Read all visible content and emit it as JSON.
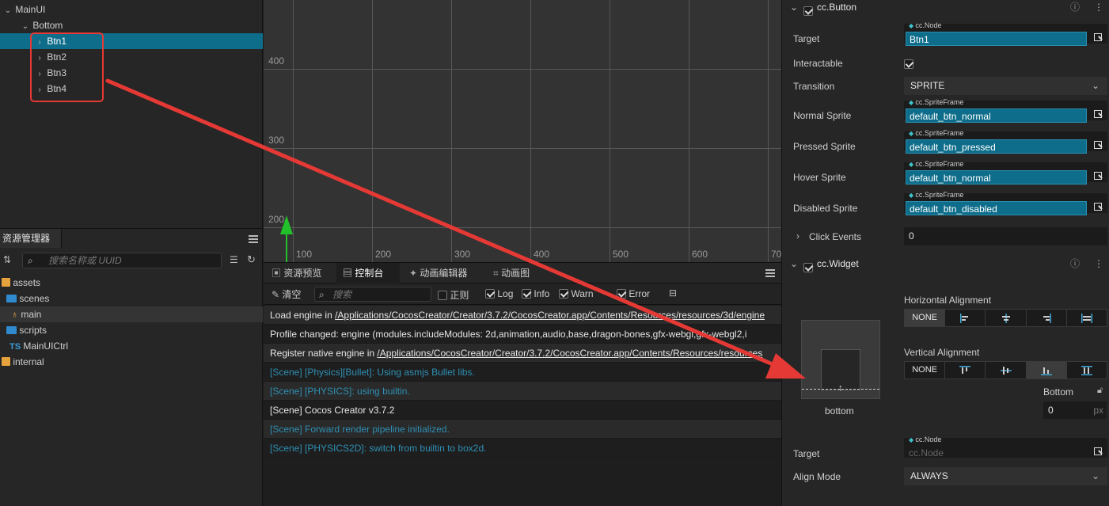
{
  "hierarchy": {
    "rows": [
      {
        "label": "MainUI"
      },
      {
        "label": "Bottom"
      },
      {
        "label": "Btn1"
      },
      {
        "label": "Btn2"
      },
      {
        "label": "Btn3"
      },
      {
        "label": "Btn4"
      }
    ]
  },
  "assets_panel": {
    "title": "资源管理器",
    "search_placeholder": "搜索名称或 UUID",
    "items": [
      {
        "label": "assets"
      },
      {
        "label": "scenes"
      },
      {
        "label": "main"
      },
      {
        "label": "scripts"
      },
      {
        "label": "MainUICtrl",
        "badge": "TS"
      },
      {
        "label": "internal"
      }
    ]
  },
  "scene": {
    "y_ticks": [
      "400",
      "300",
      "200"
    ],
    "x_ticks": [
      "100",
      "200",
      "300",
      "400",
      "500",
      "600",
      "70"
    ]
  },
  "console": {
    "tabs": [
      {
        "label": "资源预览"
      },
      {
        "label": "控制台"
      },
      {
        "label": "动画编辑器"
      },
      {
        "label": "动画图"
      }
    ],
    "clear_label": "清空",
    "search_placeholder": "搜索",
    "filters": [
      {
        "label": "正则",
        "checked": false
      },
      {
        "label": "Log",
        "checked": true
      },
      {
        "label": "Info",
        "checked": true
      },
      {
        "label": "Warn",
        "checked": true
      },
      {
        "label": "Error",
        "checked": true
      }
    ],
    "logs": [
      {
        "prefix": "Load engine in ",
        "link": "/Applications/CocosCreator/Creator/3.7.2/CocosCreator.app/Contents/Resources/resources/3d/engine"
      },
      {
        "prefix": "Profile changed: engine (modules.includeModules: 2d,animation,audio,base,dragon-bones,gfx-webgl,gfx-webgl2,i",
        "link": ""
      },
      {
        "prefix": "Register native engine in ",
        "link": "/Applications/CocosCreator/Creator/3.7.2/CocosCreator.app/Contents/Resources/resources"
      },
      {
        "prefix": "[Scene] [Physics][Bullet]: Using asmjs Bullet libs.",
        "link": ""
      },
      {
        "prefix": "[Scene] [PHYSICS]: using builtin.",
        "link": ""
      },
      {
        "prefix": "[Scene] Cocos Creator v3.7.2",
        "link": ""
      },
      {
        "prefix": "[Scene] Forward render pipeline initialized.",
        "link": ""
      },
      {
        "prefix": "[Scene] [PHYSICS2D]: switch from builtin to box2d.",
        "link": ""
      }
    ]
  },
  "inspector": {
    "button_component": {
      "title": "cc.Button",
      "target_label": "Target",
      "target_type": "cc.Node",
      "target_value": "Btn1",
      "interactable_label": "Interactable",
      "transition_label": "Transition",
      "transition_value": "SPRITE",
      "sprites": [
        {
          "label": "Normal Sprite",
          "type": "cc.SpriteFrame",
          "value": "default_btn_normal"
        },
        {
          "label": "Pressed Sprite",
          "type": "cc.SpriteFrame",
          "value": "default_btn_pressed"
        },
        {
          "label": "Hover Sprite",
          "type": "cc.SpriteFrame",
          "value": "default_btn_normal"
        },
        {
          "label": "Disabled Sprite",
          "type": "cc.SpriteFrame",
          "value": "default_btn_disabled"
        }
      ],
      "click_events_label": "Click Events",
      "click_events_value": "0"
    },
    "widget_component": {
      "title": "cc.Widget",
      "horizontal_label": "Horizontal Alignment",
      "vertical_label": "Vertical Alignment",
      "none_label": "NONE",
      "preview_caption": "bottom",
      "bottom_label": "Bottom",
      "bottom_value": "0",
      "bottom_unit": "px",
      "target_label": "Target",
      "target_type": "cc.Node",
      "target_placeholder": "cc.Node",
      "align_mode_label": "Align Mode",
      "align_mode_value": "ALWAYS"
    }
  },
  "colors": {
    "selection": "#0e6d8a",
    "annotation_red": "#e53935",
    "axis_green": "#22c02a",
    "log_blue": "#2e8fb3"
  }
}
